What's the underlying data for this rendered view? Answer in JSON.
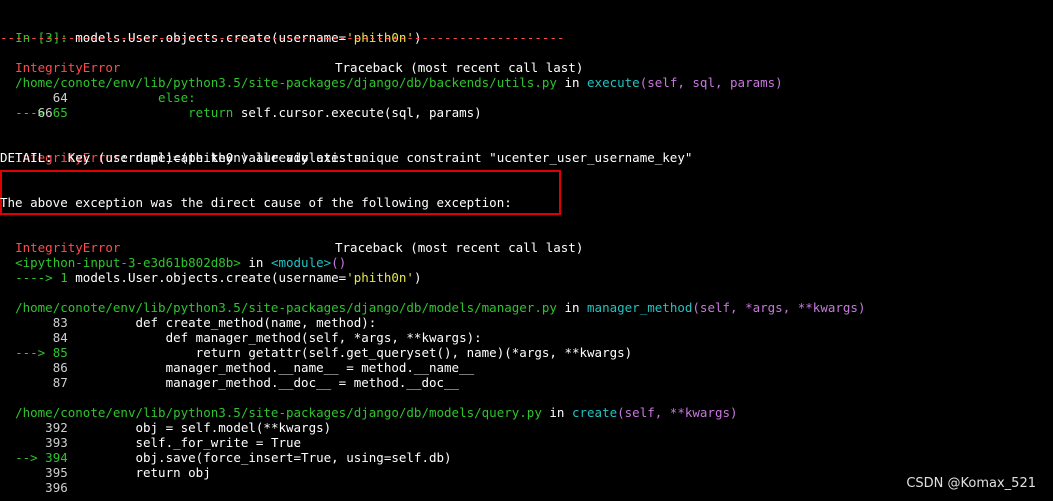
{
  "prompt": {
    "in_label": "In [3]: ",
    "code_a": "models.User.objects.create(username=",
    "str": "'phith0n'",
    "code_b": ")"
  },
  "separator": "---------------------------------------------------------------------------",
  "tb1": {
    "err_name": "IntegrityError",
    "header": "Traceback (most recent call last)",
    "file_path": "/home/conote/env/lib/python3.5/site-packages/django/db/backends/utils.py",
    "file_in": " in ",
    "func_name": "execute",
    "func_args": "(self, sql, params)",
    "l64_no": "     64",
    "l64_code": "            else:",
    "l65_arrow": "---> 65",
    "l65_kw": "                return",
    "l65_code": " self.cursor.execute(sql, params)",
    "l66_no": "     66",
    "error_line": ": duplicate key value violates unique constraint \"ucenter_user_username_key\"",
    "detail": "DETAIL:  Key (username)=(phith0n) already exists."
  },
  "cause": "The above exception was the direct cause of the following exception:",
  "tb2": {
    "err_name": "IntegrityError",
    "header": "Traceback (most recent call last)",
    "input_ref": "<ipython-input-3-e3d61b802d8b>",
    "in_word": " in ",
    "module": "<module>",
    "module_paren": "()",
    "arrow_line": "----> 1 ",
    "arrow_code": "models.User.objects.create(username=",
    "arrow_str": "'phith0n'",
    "arrow_end": ")"
  },
  "tb3": {
    "file_path": "/home/conote/env/lib/python3.5/site-packages/django/db/models/manager.py",
    "file_in": " in ",
    "func_name": "manager_method",
    "func_args": "(self, *args, **kwargs)",
    "lines": [
      {
        "no": "     83",
        "text": "         def create_method(name, method):"
      },
      {
        "no": "     84",
        "text": "             def manager_method(self, *args, **kwargs):"
      },
      {
        "no": "---> 85",
        "text": "                 return getattr(self.get_queryset(), name)(*args, **kwargs)"
      },
      {
        "no": "     86",
        "text": "             manager_method.__name__ = method.__name__"
      },
      {
        "no": "     87",
        "text": "             manager_method.__doc__ = method.__doc__"
      }
    ]
  },
  "tb4": {
    "file_path": "/home/conote/env/lib/python3.5/site-packages/django/db/models/query.py",
    "file_in": " in ",
    "func_name": "create",
    "func_args": "(self, **kwargs)",
    "lines": [
      {
        "no": "    392",
        "text": "         obj = self.model(**kwargs)"
      },
      {
        "no": "    393",
        "text": "         self._for_write = True"
      },
      {
        "no": "--> 394",
        "text": "         obj.save(force_insert=True, using=self.db)"
      },
      {
        "no": "    395",
        "text": "         return obj"
      },
      {
        "no": "    396",
        "text": ""
      }
    ]
  },
  "watermark": "CSDN @Komax_521"
}
